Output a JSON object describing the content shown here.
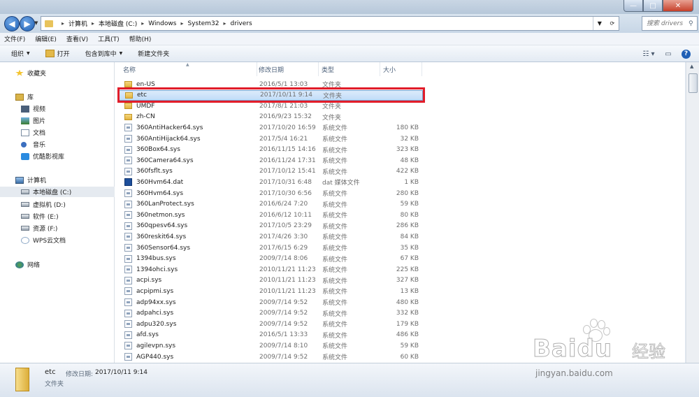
{
  "window": {
    "min_glyph": "—",
    "max_glyph": "□",
    "close_glyph": "✕"
  },
  "address": {
    "crumbs": [
      "计算机",
      "本地磁盘 (C:)",
      "Windows",
      "System32",
      "drivers"
    ],
    "search_placeholder": "搜索 drivers"
  },
  "menu": [
    "文件(F)",
    "编辑(E)",
    "查看(V)",
    "工具(T)",
    "帮助(H)"
  ],
  "toolbar": {
    "organize": "组织",
    "open": "打开",
    "include_library": "包含到库中",
    "new_folder": "新建文件夹"
  },
  "nav": {
    "favorites": "收藏夹",
    "libraries": "库",
    "lib_items": [
      "视频",
      "图片",
      "文档",
      "音乐",
      "优酷影视库"
    ],
    "computer": "计算机",
    "drives": [
      "本地磁盘 (C:)",
      "虚拟机 (D:)",
      "软件 (E:)",
      "资源 (F:)"
    ],
    "wps": "WPS云文档",
    "network": "网络"
  },
  "columns": {
    "name": "名称",
    "date": "修改日期",
    "type": "类型",
    "size": "大小"
  },
  "files": [
    {
      "name": "en-US",
      "date": "2016/5/1 13:03",
      "type": "文件夹",
      "size": "",
      "icon": "folder"
    },
    {
      "name": "etc",
      "date": "2017/10/11 9:14",
      "type": "文件夹",
      "size": "",
      "icon": "folder",
      "selected": true
    },
    {
      "name": "UMDF",
      "date": "2017/8/1 21:03",
      "type": "文件夹",
      "size": "",
      "icon": "folder"
    },
    {
      "name": "zh-CN",
      "date": "2016/9/23 15:32",
      "type": "文件夹",
      "size": "",
      "icon": "folder"
    },
    {
      "name": "360AntiHacker64.sys",
      "date": "2017/10/20 16:59",
      "type": "系统文件",
      "size": "180 KB",
      "icon": "sys"
    },
    {
      "name": "360AntiHijack64.sys",
      "date": "2017/5/4 16:21",
      "type": "系统文件",
      "size": "32 KB",
      "icon": "sys"
    },
    {
      "name": "360Box64.sys",
      "date": "2016/11/15 14:16",
      "type": "系统文件",
      "size": "323 KB",
      "icon": "sys"
    },
    {
      "name": "360Camera64.sys",
      "date": "2016/11/24 17:31",
      "type": "系统文件",
      "size": "48 KB",
      "icon": "sys"
    },
    {
      "name": "360fsflt.sys",
      "date": "2017/10/12 15:41",
      "type": "系统文件",
      "size": "422 KB",
      "icon": "sys"
    },
    {
      "name": "360Hvm64.dat",
      "date": "2017/10/31 6:48",
      "type": "dat 媒体文件",
      "size": "1 KB",
      "icon": "dat"
    },
    {
      "name": "360Hvm64.sys",
      "date": "2017/10/30 6:56",
      "type": "系统文件",
      "size": "280 KB",
      "icon": "sys"
    },
    {
      "name": "360LanProtect.sys",
      "date": "2016/6/24 7:20",
      "type": "系统文件",
      "size": "59 KB",
      "icon": "sys"
    },
    {
      "name": "360netmon.sys",
      "date": "2016/6/12 10:11",
      "type": "系统文件",
      "size": "80 KB",
      "icon": "sys"
    },
    {
      "name": "360qpesv64.sys",
      "date": "2017/10/5 23:29",
      "type": "系统文件",
      "size": "286 KB",
      "icon": "sys"
    },
    {
      "name": "360reskit64.sys",
      "date": "2017/4/26 3:30",
      "type": "系统文件",
      "size": "84 KB",
      "icon": "sys"
    },
    {
      "name": "360Sensor64.sys",
      "date": "2017/6/15 6:29",
      "type": "系统文件",
      "size": "35 KB",
      "icon": "sys"
    },
    {
      "name": "1394bus.sys",
      "date": "2009/7/14 8:06",
      "type": "系统文件",
      "size": "67 KB",
      "icon": "sys"
    },
    {
      "name": "1394ohci.sys",
      "date": "2010/11/21 11:23",
      "type": "系统文件",
      "size": "225 KB",
      "icon": "sys"
    },
    {
      "name": "acpi.sys",
      "date": "2010/11/21 11:23",
      "type": "系统文件",
      "size": "327 KB",
      "icon": "sys"
    },
    {
      "name": "acpipmi.sys",
      "date": "2010/11/21 11:23",
      "type": "系统文件",
      "size": "13 KB",
      "icon": "sys"
    },
    {
      "name": "adp94xx.sys",
      "date": "2009/7/14 9:52",
      "type": "系统文件",
      "size": "480 KB",
      "icon": "sys"
    },
    {
      "name": "adpahci.sys",
      "date": "2009/7/14 9:52",
      "type": "系统文件",
      "size": "332 KB",
      "icon": "sys"
    },
    {
      "name": "adpu320.sys",
      "date": "2009/7/14 9:52",
      "type": "系统文件",
      "size": "179 KB",
      "icon": "sys"
    },
    {
      "name": "afd.sys",
      "date": "2016/5/1 13:33",
      "type": "系统文件",
      "size": "486 KB",
      "icon": "sys"
    },
    {
      "name": "agilevpn.sys",
      "date": "2009/7/14 8:10",
      "type": "系统文件",
      "size": "59 KB",
      "icon": "sys"
    },
    {
      "name": "AGP440.sys",
      "date": "2009/7/14 9:52",
      "type": "系统文件",
      "size": "60 KB",
      "icon": "sys"
    }
  ],
  "details": {
    "name": "etc",
    "modified_label": "修改日期:",
    "modified_value": "2017/10/11 9:14",
    "type": "文件夹"
  },
  "watermark": {
    "brand": "Baidu",
    "cn": "经验",
    "url": "jingyan.baidu.com"
  }
}
